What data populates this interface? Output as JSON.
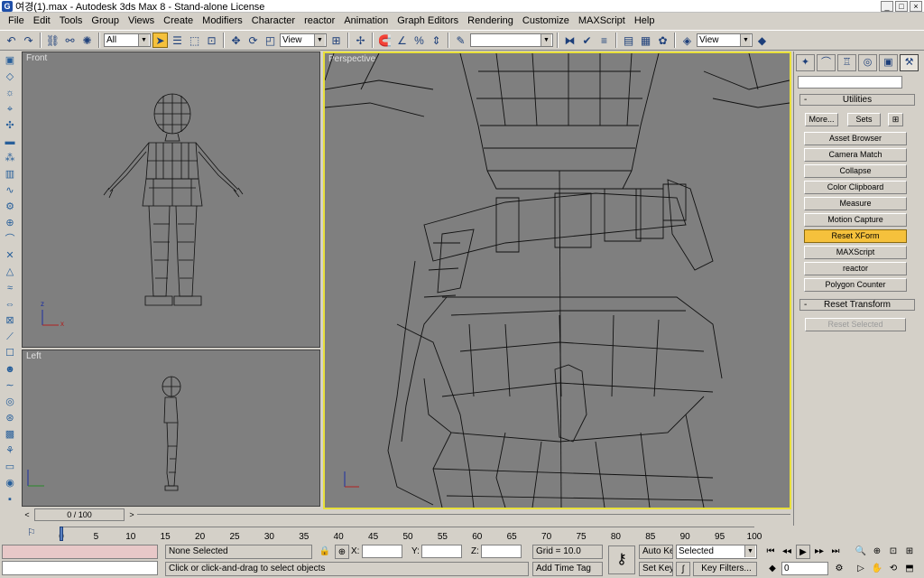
{
  "window": {
    "title": "여경(1).max - Autodesk 3ds Max 8 - Stand-alone License",
    "buttons": [
      "_",
      "□",
      "×"
    ]
  },
  "menu": [
    "File",
    "Edit",
    "Tools",
    "Group",
    "Views",
    "Create",
    "Modifiers",
    "Character",
    "reactor",
    "Animation",
    "Graph Editors",
    "Rendering",
    "Customize",
    "MAXScript",
    "Help"
  ],
  "toolbar": {
    "selection_filter": "All",
    "ref_coord": "View",
    "named_sel": "",
    "render_view": "View"
  },
  "viewports": {
    "front": "Front",
    "left": "Left",
    "perspective": "Perspective"
  },
  "axes": {
    "z": "z",
    "x": "x",
    "y": "y"
  },
  "command_panel": {
    "rollout_utilities": "Utilities",
    "more_label": "More...",
    "sets_label": "Sets",
    "utilities": [
      "Asset Browser",
      "Camera Match",
      "Collapse",
      "Color Clipboard",
      "Measure",
      "Motion Capture",
      "Reset XForm",
      "MAXScript",
      "reactor",
      "Polygon Counter"
    ],
    "selected_utility": "Reset XForm",
    "rollout_reset": "Reset Transform",
    "reset_selected_label": "Reset Selected"
  },
  "timeline": {
    "frame_display": "0 / 100",
    "ticks": [
      "0",
      "5",
      "10",
      "15",
      "20",
      "25",
      "30",
      "35",
      "40",
      "45",
      "50",
      "55",
      "60",
      "65",
      "70",
      "75",
      "80",
      "85",
      "90",
      "95",
      "100"
    ]
  },
  "status": {
    "selection": "None Selected",
    "prompt": "Click or click-and-drag to select objects",
    "x_label": "X:",
    "y_label": "Y:",
    "z_label": "Z:",
    "grid": "Grid = 10.0",
    "add_time_tag": "Add Time Tag",
    "auto_key": "Auto Key",
    "set_key": "Set Key",
    "key_mode_value": "Selected",
    "key_filters": "Key Filters...",
    "current_frame": "0"
  },
  "colors": {
    "viewport_bg": "#7f7f7f",
    "active_border": "#e8e03a",
    "selected_button": "#f5c13c",
    "wire": "#111111"
  }
}
